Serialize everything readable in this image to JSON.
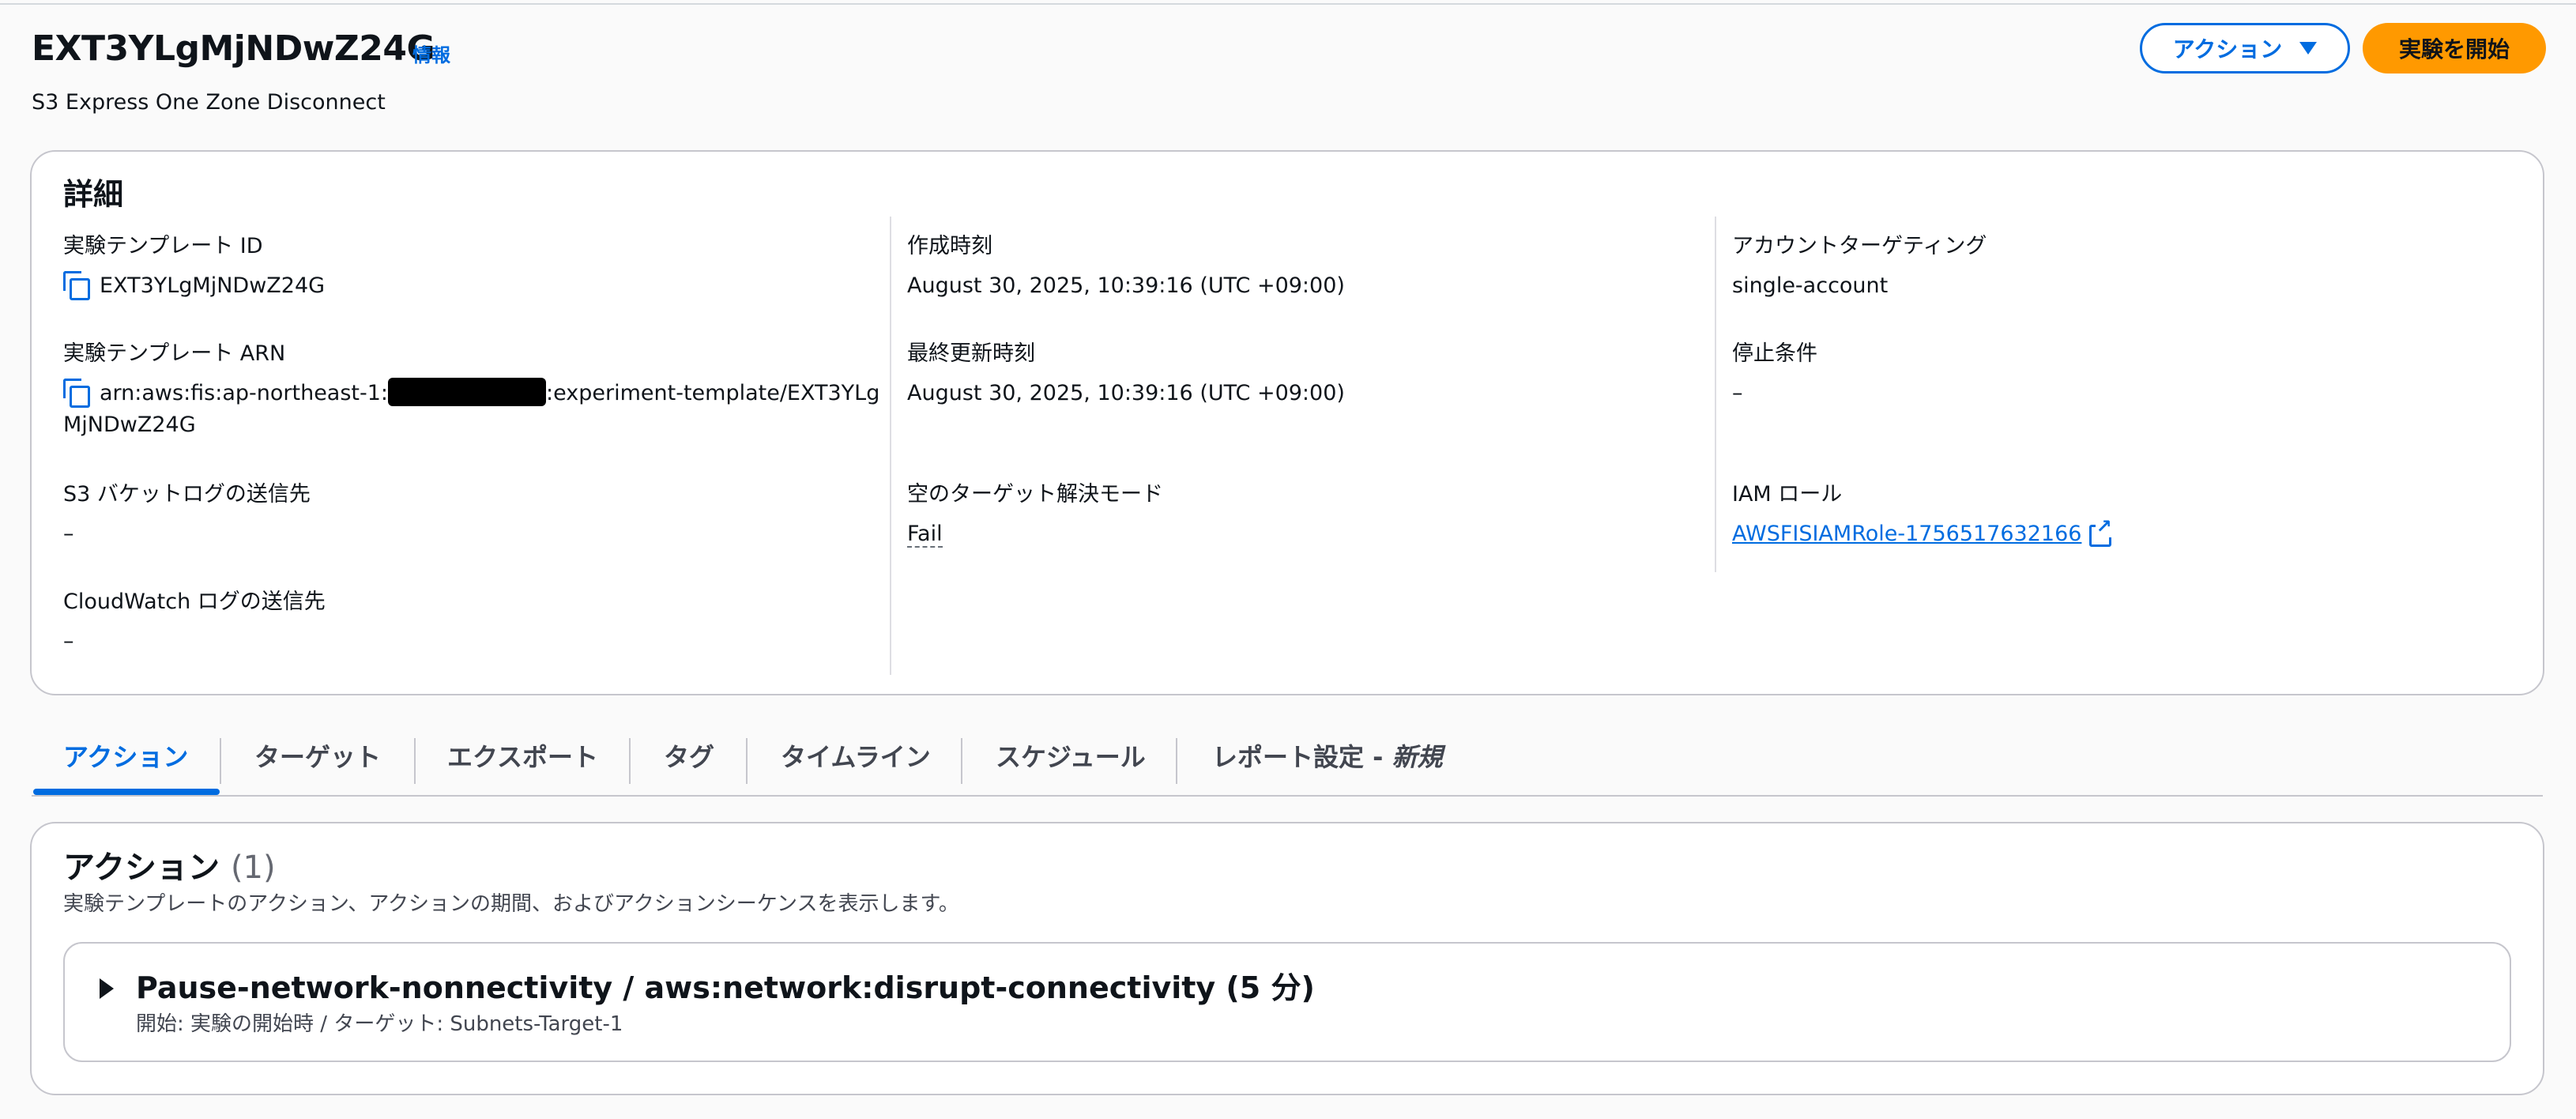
{
  "header": {
    "title": "EXT3YLgMjNDwZ24G",
    "info_link": "情報",
    "description": "S3 Express One Zone Disconnect",
    "actions_button": "アクション",
    "start_button": "実験を開始"
  },
  "details": {
    "heading": "詳細",
    "template_id_label": "実験テンプレート ID",
    "template_id_value": "EXT3YLgMjNDwZ24G",
    "arn_label": "実験テンプレート ARN",
    "arn_prefix": "arn:aws:fis:ap-northeast-1:",
    "arn_suffix": ":experiment-template/EXT3YLgMjNDwZ24G",
    "s3_log_label": "S3 バケットログの送信先",
    "s3_log_value": "–",
    "cloudwatch_log_label": "CloudWatch ログの送信先",
    "cloudwatch_log_value": "–",
    "created_label": "作成時刻",
    "created_value": "August 30, 2025, 10:39:16 (UTC +09:00)",
    "updated_label": "最終更新時刻",
    "updated_value": "August 30, 2025, 10:39:16 (UTC +09:00)",
    "empty_target_label": "空のターゲット解決モード",
    "empty_target_value": "Fail",
    "account_targeting_label": "アカウントターゲティング",
    "account_targeting_value": "single-account",
    "stop_condition_label": "停止条件",
    "stop_condition_value": "–",
    "iam_role_label": "IAM ロール",
    "iam_role_value": "AWSFISIAMRole-1756517632166"
  },
  "tabs": [
    {
      "label": "アクション",
      "active": true
    },
    {
      "label": "ターゲット"
    },
    {
      "label": "エクスポート"
    },
    {
      "label": "タグ"
    },
    {
      "label": "タイムライン"
    },
    {
      "label": "スケジュール"
    },
    {
      "label": "レポート設定 - ",
      "suffix": "新規"
    }
  ],
  "actions_section": {
    "title": "アクション",
    "count": "(1)",
    "description": "実験テンプレートのアクション、アクションの期間、およびアクションシーケンスを表示します。",
    "items": [
      {
        "title": "Pause-network-nonnectivity / aws:network:disrupt-connectivity (5 分)",
        "subtitle": "開始: 実験の開始時 / ターゲット: Subnets-Target-1"
      }
    ]
  },
  "icons": {
    "copy": "copy-icon",
    "external_link": "external-link-icon",
    "dropdown": "caret-down-icon",
    "expand": "triangle-right-icon"
  },
  "colors": {
    "link": "#006ce0",
    "primary_button": "#ff9900",
    "border": "#c6c6cd"
  }
}
